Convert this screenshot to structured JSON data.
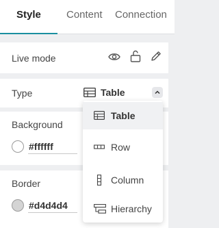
{
  "tabs": [
    {
      "label": "Style",
      "active": true
    },
    {
      "label": "Content",
      "active": false
    },
    {
      "label": "Connection",
      "active": false
    }
  ],
  "accent_color": "#1a8fa0",
  "live_mode": {
    "label": "Live mode",
    "icons": [
      "eye-icon",
      "unlock-icon",
      "pencil-icon"
    ]
  },
  "type": {
    "label": "Type",
    "value": "Table",
    "value_icon": "table-icon"
  },
  "background": {
    "label": "Background",
    "value": "#ffffff"
  },
  "border": {
    "label": "Border",
    "value": "#d4d4d4"
  },
  "type_options": [
    {
      "label": "Table",
      "icon": "table-icon",
      "selected": true
    },
    {
      "label": "Row",
      "icon": "row-icon",
      "selected": false
    },
    {
      "label": "Column",
      "icon": "column-icon",
      "selected": false
    },
    {
      "label": "Hierarchy",
      "icon": "hierarchy-icon",
      "selected": false
    }
  ]
}
